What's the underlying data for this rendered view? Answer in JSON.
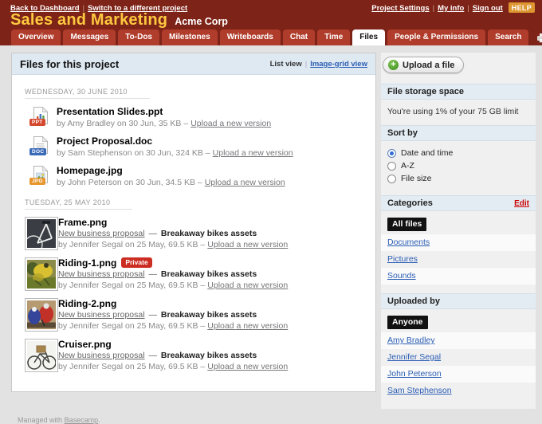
{
  "header": {
    "sep": "|",
    "nav": {
      "back": "Back to Dashboard",
      "switch_project": "Switch to a different project",
      "project_settings": "Project Settings",
      "my_info": "My info",
      "sign_out": "Sign out",
      "help": "HELP"
    },
    "project_title": "Sales and Marketing",
    "company": "Acme Corp",
    "tabs": [
      "Overview",
      "Messages",
      "To-Dos",
      "Milestones",
      "Writeboards",
      "Chat",
      "Time",
      "Files"
    ],
    "active_tab": "Files",
    "tabs_right": [
      "People & Permissions",
      "Search"
    ]
  },
  "main": {
    "title": "Files for this project",
    "view_current": "List view",
    "view_sep": "|",
    "view_alt": "Image-grid view",
    "sep": "—",
    "groups": [
      {
        "date": "WEDNESDAY, 30 JUNE 2010",
        "files": [
          {
            "name": "Presentation Slides.ppt",
            "icon": "ppt-file-icon",
            "badge": "PPT",
            "meta": "by Amy Bradley on 30 Jun, 35 KB –",
            "upload_label": "Upload a new version"
          },
          {
            "name": "Project Proposal.doc",
            "icon": "doc-file-icon",
            "badge": "DOC",
            "meta": "by Sam Stephenson on 30 Jun, 324 KB –",
            "upload_label": "Upload a new version"
          },
          {
            "name": "Homepage.jpg",
            "icon": "jpg-file-icon",
            "badge": "JPG",
            "meta": "by John Peterson on 30 Jun, 34.5 KB –",
            "upload_label": "Upload a new version"
          }
        ]
      },
      {
        "date": "TUESDAY, 25 MAY 2010",
        "files": [
          {
            "name": "Frame.png",
            "thumb": "bike-frame-photo",
            "category": "New business proposal",
            "description": "Breakaway bikes assets",
            "meta": "by Jennifer Segal on 25 May, 69.5 KB –",
            "upload_label": "Upload a new version"
          },
          {
            "name": "Riding-1.png",
            "private_label": "Private",
            "thumb": "riding-1-photo",
            "category": "New business proposal",
            "description": "Breakaway bikes assets",
            "meta": "by Jennifer Segal on 25 May, 69.5 KB –",
            "upload_label": "Upload a new version"
          },
          {
            "name": "Riding-2.png",
            "thumb": "riding-2-photo",
            "category": "New business proposal",
            "description": "Breakaway bikes assets",
            "meta": "by Jennifer Segal on 25 May, 69.5 KB –",
            "upload_label": "Upload a new version"
          },
          {
            "name": "Cruiser.png",
            "thumb": "cruiser-photo",
            "category": "New business proposal",
            "description": "Breakaway bikes assets",
            "meta": "by Jennifer Segal on 25 May, 69.5 KB –",
            "upload_label": "Upload a new version"
          }
        ]
      }
    ]
  },
  "sidebar": {
    "upload_button": "Upload a file",
    "storage": {
      "title": "File storage space",
      "usage_text": "You're using 1% of your 75 GB limit"
    },
    "sort": {
      "title": "Sort by",
      "options": [
        {
          "label": "Date and time",
          "selected": true
        },
        {
          "label": "A-Z",
          "selected": false
        },
        {
          "label": "File size",
          "selected": false
        }
      ]
    },
    "categories": {
      "title": "Categories",
      "edit_label": "Edit",
      "selected_label": "All files",
      "links": [
        "Documents",
        "Pictures",
        "Sounds"
      ]
    },
    "uploaded_by": {
      "title": "Uploaded by",
      "selected_label": "Anyone",
      "links": [
        "Amy Bradley",
        "Jennifer Segal",
        "John Peterson",
        "Sam Stephenson"
      ]
    }
  },
  "footer": {
    "text": "Managed with",
    "link": "Basecamp",
    "period": "."
  },
  "colors": {
    "header_bg": "#7e2318",
    "tab_bg": "#b03c2b",
    "title_yellow": "#fdc93f",
    "link_blue": "#2b5db4",
    "selected_filter_bg": "#111111",
    "private_badge": "#cc2d22",
    "help_badge": "#dd9630",
    "section_header_bg": "#e3ecf3"
  }
}
